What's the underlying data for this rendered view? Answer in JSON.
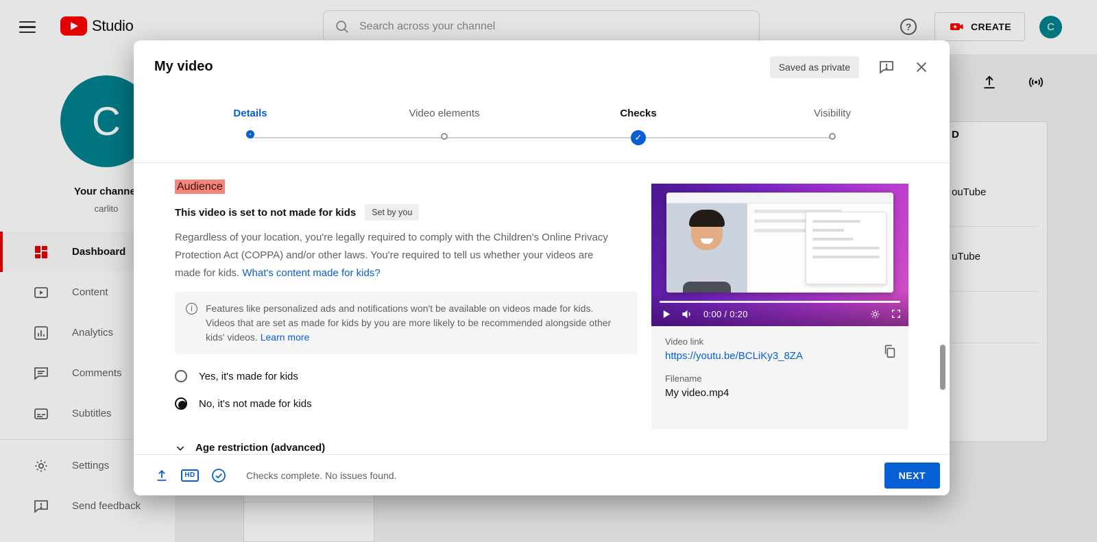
{
  "topbar": {
    "brand": "Studio",
    "search_placeholder": "Search across your channel",
    "help_glyph": "?",
    "create_label": "CREATE",
    "avatar_letter": "C"
  },
  "sidebar": {
    "avatar_letter": "C",
    "channel_label": "Your channel",
    "channel_name": "carlito",
    "items": [
      {
        "label": "Dashboard"
      },
      {
        "label": "Content"
      },
      {
        "label": "Analytics"
      },
      {
        "label": "Comments"
      },
      {
        "label": "Subtitles"
      },
      {
        "label": "Settings"
      },
      {
        "label": "Send feedback"
      }
    ]
  },
  "background": {
    "heading_fragment": "D",
    "item1_fragment": "ouTube",
    "item2_fragment": "uTube"
  },
  "dialog": {
    "title": "My video",
    "saved_badge": "Saved as private",
    "steps": {
      "details": "Details",
      "video_elements": "Video elements",
      "checks": "Checks",
      "visibility": "Visibility"
    },
    "audience": {
      "heading": "Audience",
      "status": "This video is set to not made for kids",
      "set_by": "Set by you",
      "legal_text": "Regardless of your location, you're legally required to comply with the Children's Online Privacy Protection Act (COPPA) and/or other laws. You're required to tell us whether your videos are made for kids. ",
      "legal_link": "What's content made for kids?",
      "info_text": "Features like personalized ads and notifications won't be available on videos made for kids. Videos that are set as made for kids by you are more likely to be recommended alongside other kids' videos. ",
      "info_link": "Learn more",
      "option_yes": "Yes, it's made for kids",
      "option_no": "No, it's not made for kids",
      "age_restriction": "Age restriction (advanced)"
    },
    "player": {
      "time": "0:00 / 0:20"
    },
    "details_panel": {
      "video_link_label": "Video link",
      "video_link": "https://youtu.be/BCLiKy3_8ZA",
      "filename_label": "Filename",
      "filename": "My video.mp4"
    },
    "footer": {
      "hd": "HD",
      "status": "Checks complete. No issues found.",
      "next": "NEXT"
    }
  },
  "colors": {
    "accent_blue": "#065fd4",
    "brand_red": "#ff0000",
    "avatar_teal": "#00838f",
    "audience_highlight": "#f3877d"
  }
}
